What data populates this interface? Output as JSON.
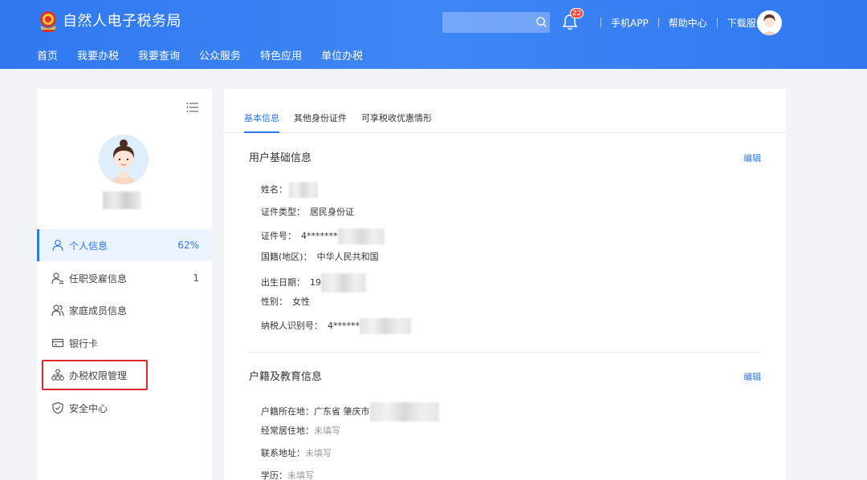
{
  "header": {
    "site_title": "自然人电子税务局",
    "search_placeholder": "",
    "notification_count": "22",
    "links": [
      "手机APP",
      "帮助中心",
      "下载服务"
    ]
  },
  "nav": [
    "首页",
    "我要办税",
    "我要查询",
    "公众服务",
    "特色应用",
    "单位办税"
  ],
  "sidebar": {
    "items": [
      {
        "label": "个人信息",
        "count": "62%",
        "icon": "user-icon",
        "active": true
      },
      {
        "label": "任职受雇信息",
        "count": "1",
        "icon": "user-list-icon"
      },
      {
        "label": "家庭成员信息",
        "count": "",
        "icon": "family-icon"
      },
      {
        "label": "银行卡",
        "count": "",
        "icon": "bank-card-icon"
      },
      {
        "label": "办税权限管理",
        "count": "",
        "icon": "org-chart-icon",
        "highlighted": true
      },
      {
        "label": "安全中心",
        "count": "",
        "icon": "shield-icon"
      }
    ]
  },
  "tabs": [
    "基本信息",
    "其他身份证件",
    "可享税收优惠情形"
  ],
  "basic": {
    "title": "用户基础信息",
    "edit": "编辑",
    "fields": {
      "name_label": "姓名：",
      "id_type_label": "证件类型：",
      "id_type_value": "居民身份证",
      "id_no_label": "证件号：",
      "id_no_value": "4*******",
      "nationality_label": "国籍(地区)：",
      "nationality_value": "中华人民共和国",
      "birth_label": "出生日期：",
      "birth_value": "19",
      "gender_label": "性别：",
      "gender_value": "女性",
      "taxpayer_id_label": "纳税人识别号：",
      "taxpayer_id_value": "4******"
    }
  },
  "household": {
    "title": "户籍及教育信息",
    "edit": "编辑",
    "fields": {
      "hukou_label": "户籍所在地：",
      "hukou_value": "广东省 肇庆市",
      "residence_label": "经常居住地：",
      "residence_value": "未填写",
      "address_label": "联系地址：",
      "address_value": "未填写",
      "education_label": "学历：",
      "education_value": "未填写"
    }
  },
  "colors": {
    "primary": "#2f78f0",
    "highlight": "#e0262a",
    "badge": "#f04b3c"
  }
}
